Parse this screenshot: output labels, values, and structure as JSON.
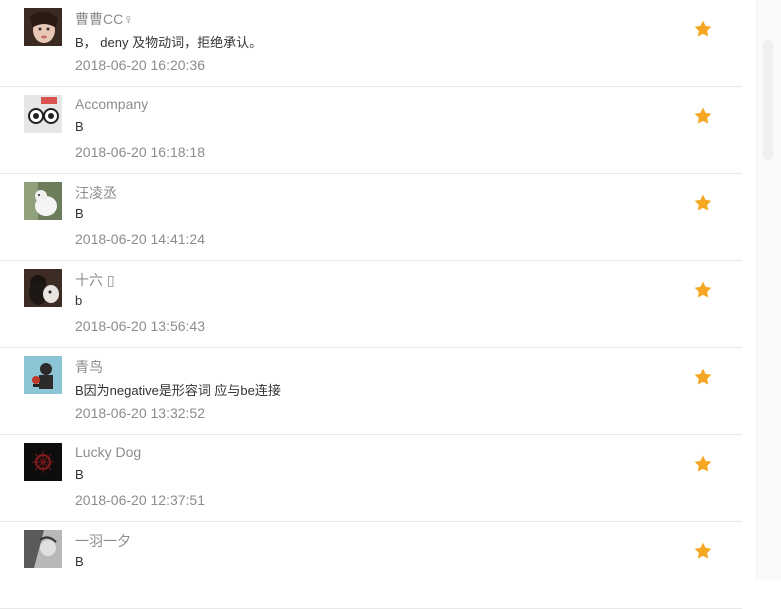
{
  "comments": [
    {
      "name": "曹曹CC♀",
      "text": "B， deny 及物动词，拒绝承认。",
      "time": "2018-06-20 16:20:36",
      "avatar": "girl-face",
      "icon": "star-icon"
    },
    {
      "name": "Accompany",
      "text": "B",
      "time": "2018-06-20 16:18:18",
      "avatar": "cartoon-eyes",
      "icon": "star-icon"
    },
    {
      "name": "汪凌丞",
      "text": "B",
      "time": "2018-06-20 14:41:24",
      "avatar": "white-cat",
      "icon": "star-icon"
    },
    {
      "name": "十六 ▯",
      "text": "b",
      "time": "2018-06-20 13:56:43",
      "avatar": "person-with-dog",
      "icon": "star-icon"
    },
    {
      "name": "青鸟",
      "text": "B因为negative是形容词 应与be连接",
      "time": "2018-06-20 13:32:52",
      "avatar": "illustration-blue",
      "icon": "star-icon"
    },
    {
      "name": "Lucky Dog",
      "text": "B",
      "time": "2018-06-20 12:37:51",
      "avatar": "dark-emblem",
      "icon": "star-icon"
    },
    {
      "name": "一羽一夕",
      "text": "B",
      "time": "",
      "avatar": "monochrome-art",
      "icon": "star-icon"
    }
  ],
  "colors": {
    "star": "#f5a623",
    "name": "#8c8c8c",
    "text": "#333333",
    "divider": "#e8e8e8"
  }
}
